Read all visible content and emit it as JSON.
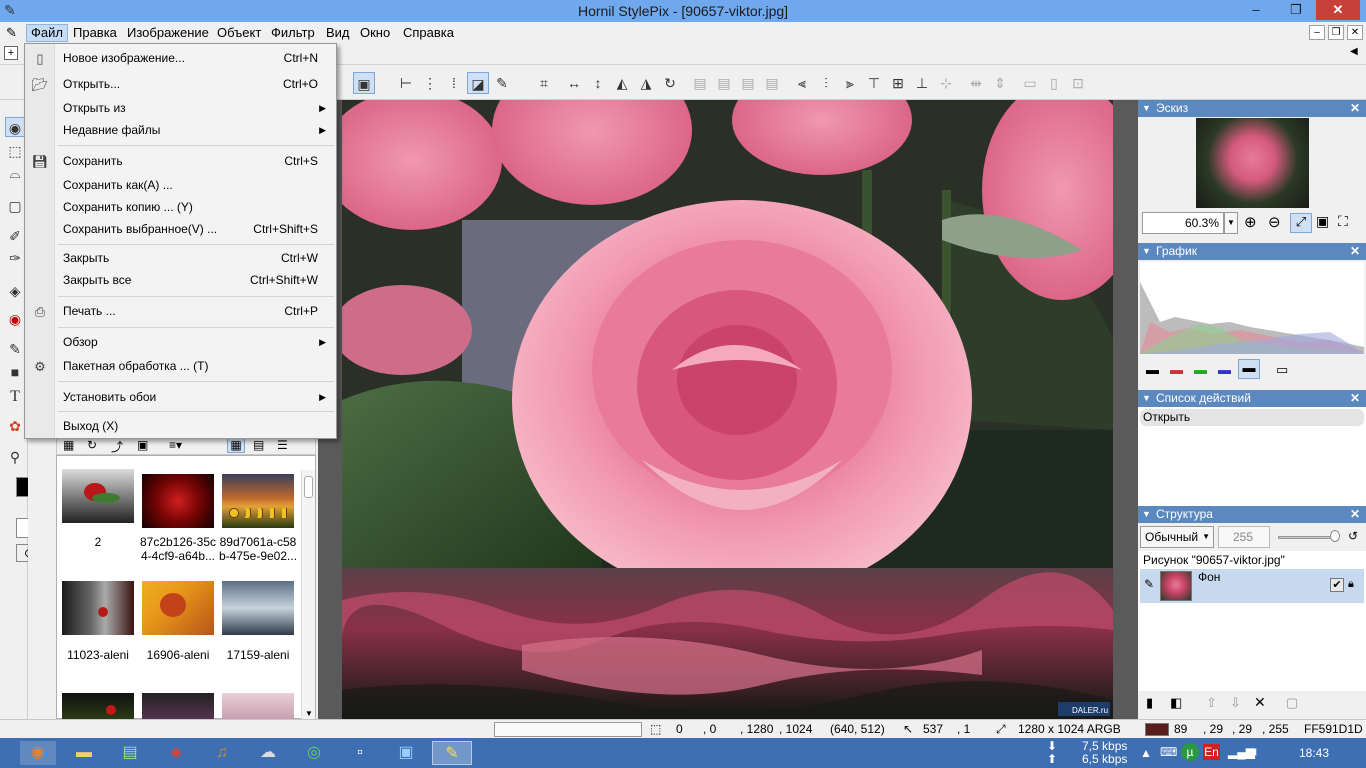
{
  "window": {
    "title": "Hornil StylePix - [90657-viktor.jpg]",
    "min": "‒",
    "max": "❐",
    "close": "✕"
  },
  "menubar": {
    "items": [
      "Файл",
      "Правка",
      "Изображение",
      "Объект",
      "Фильтр",
      "Вид",
      "Окно",
      "Справка"
    ]
  },
  "file_menu": {
    "items": [
      {
        "label": "Новое изображение...",
        "shortcut": "Ctrl+N",
        "icon": "new-image-icon"
      },
      {
        "label": "Открыть...",
        "shortcut": "Ctrl+O",
        "icon": "open-folder-icon"
      },
      {
        "label": "Открыть из",
        "shortcut": "",
        "submenu": true
      },
      {
        "label": "Недавние файлы",
        "shortcut": "",
        "submenu": true
      },
      {
        "label": "Сохранить",
        "shortcut": "Ctrl+S",
        "icon": "save-icon"
      },
      {
        "label": "Сохранить как(A) ...",
        "shortcut": ""
      },
      {
        "label": "Сохранить копию ... (Y)",
        "shortcut": ""
      },
      {
        "label": "Сохранить выбранное(V) ...",
        "shortcut": "Ctrl+Shift+S"
      },
      {
        "label": "Закрыть",
        "shortcut": "Ctrl+W"
      },
      {
        "label": "Закрыть все",
        "shortcut": "Ctrl+Shift+W"
      },
      {
        "label": "Печать ...",
        "shortcut": "Ctrl+P",
        "icon": "printer-icon"
      },
      {
        "label": "Обзор",
        "shortcut": "",
        "submenu": true
      },
      {
        "label": "Пакетная обработка ... (T)",
        "shortcut": "",
        "icon": "gear-icon"
      },
      {
        "label": "Установить обои",
        "shortcut": "",
        "submenu": true
      },
      {
        "label": "Выход (X)",
        "shortcut": ""
      }
    ]
  },
  "browser": {
    "thumbs": [
      {
        "label": "2"
      },
      {
        "label": "87c2b126-35c\n4-4cf9-a64b..."
      },
      {
        "label": "89d7061a-c58\nb-475e-9e02..."
      },
      {
        "label": "11023-aleni"
      },
      {
        "label": "16906-aleni"
      },
      {
        "label": "17159-aleni"
      }
    ]
  },
  "panels": {
    "sketch": {
      "title": "Эскиз",
      "zoom": "60.3%"
    },
    "graph": {
      "title": "График"
    },
    "actions": {
      "title": "Список действий",
      "items": [
        "Открыть"
      ]
    },
    "structure": {
      "title": "Структура",
      "blend": "Обычный",
      "opacity": "255",
      "image_label": "Рисунок \"90657-viktor.jpg\"",
      "layer": "Фон"
    }
  },
  "status": {
    "sel_x": "0",
    "sel_y": ", 0",
    "sel_w": ", 1280",
    "sel_h": ", 1024",
    "center": "(640, 512)",
    "cursor_x": "537",
    "cursor_y": ", 1",
    "size": "1280 x 1024 ARGB",
    "r": "89",
    "g": ", 29",
    "b": ", 29",
    "a": ", 255",
    "hex": "FF591D1D",
    "color": "#591d1d"
  },
  "taskbar": {
    "net_up": "7,5 kbps",
    "net_down": "6,5 kbps",
    "lang": "En",
    "time": "18:43"
  },
  "watermark": "DALER.ru"
}
